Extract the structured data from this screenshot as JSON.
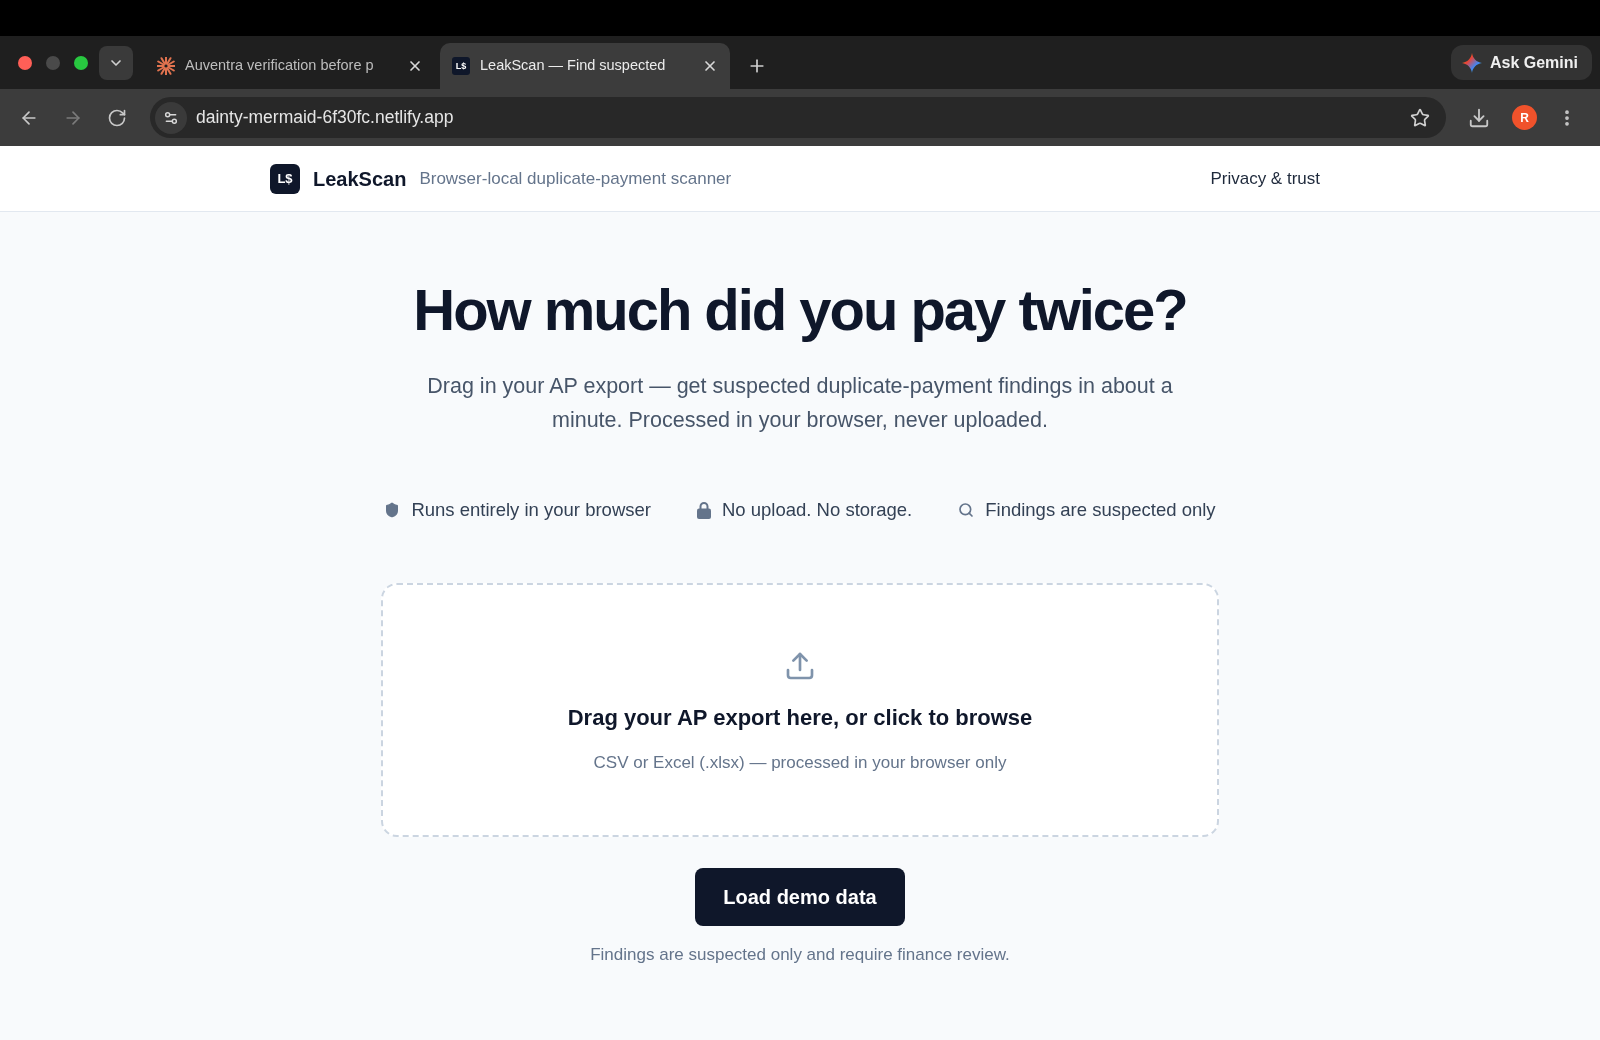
{
  "browser": {
    "tabs": [
      {
        "kind": "sunburst",
        "title": "Auventra verification before p",
        "selected": false
      },
      {
        "kind": "logo",
        "favicon_text": "L$",
        "title": "LeakScan — Find suspected",
        "selected": true
      }
    ],
    "assistant_button": "Ask Gemini",
    "nav": [
      {
        "kind": "back",
        "disabled": false
      },
      {
        "kind": "forward",
        "disabled": true
      },
      {
        "kind": "reload",
        "disabled": false
      }
    ],
    "url": "dainty-mermaid-6f30fc.netlify.app",
    "profile_initial": "R"
  },
  "header": {
    "logo": "L$",
    "brand": "LeakScan",
    "tagline": "Browser-local duplicate-payment scanner",
    "nav_link": "Privacy & trust"
  },
  "hero": {
    "title": "How much did you pay twice?",
    "subtitle": "Drag in your AP export — get suspected duplicate-payment findings in about a minute. Processed in your browser, never uploaded."
  },
  "trust_badges": [
    {
      "kind": "shield",
      "label": "Runs entirely in your browser"
    },
    {
      "kind": "lock",
      "label": "No upload. No storage."
    },
    {
      "kind": "search",
      "label": "Findings are suspected only"
    }
  ],
  "dropzone": {
    "title": "Drag your AP export here, or click to browse",
    "hint": "CSV or Excel (.xlsx) — processed in your browser only"
  },
  "demo_button": "Load demo data",
  "disclaimer": "Findings are suspected only and require finance review."
}
